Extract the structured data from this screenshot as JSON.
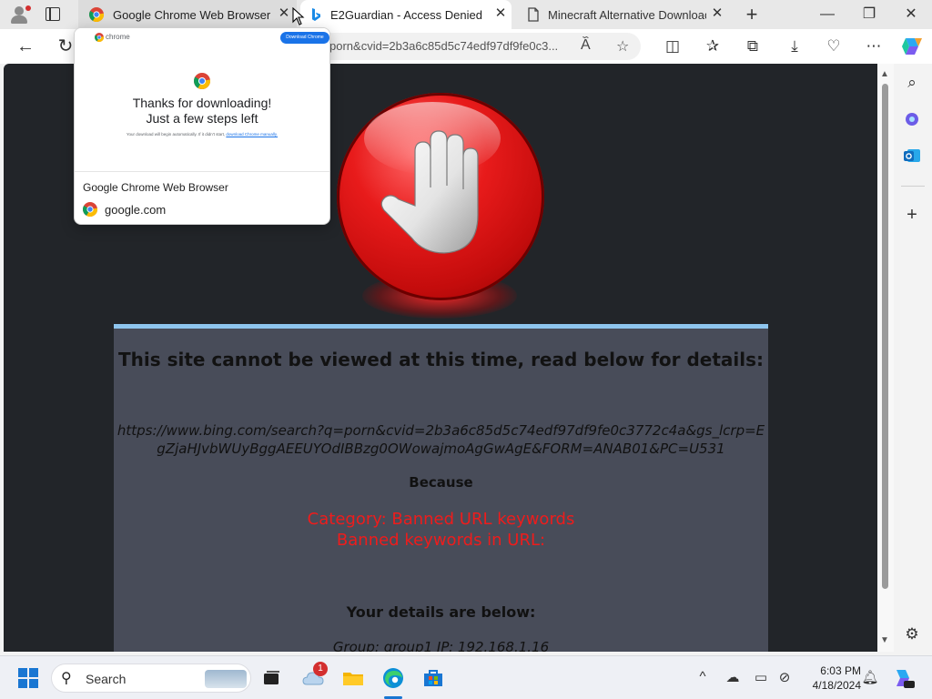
{
  "tabs": [
    {
      "title": "Google Chrome Web Browser",
      "favicon": "chrome-icon"
    },
    {
      "title": "E2Guardian - Access Denied",
      "favicon": "bing-icon"
    },
    {
      "title": "Minecraft Alternative Downloads",
      "favicon": "page-icon"
    }
  ],
  "toolbar": {
    "url": "porn&cvid=2b3a6c85d5c74edf97df9fe0c3..."
  },
  "preview": {
    "brand": "chrome",
    "download_button": "Download Chrome",
    "headline_1": "Thanks for downloading!",
    "headline_2": "Just a few steps left",
    "small_text": "Your download will begin automatically. If it didn't start,",
    "small_link": "download Chrome manually.",
    "title": "Google Chrome Web Browser",
    "domain": "google.com"
  },
  "notice": {
    "title": "This site cannot be viewed at this time, read below for details:",
    "url": "https://www.bing.com/search?q=porn&cvid=2b3a6c85d5c74edf97df9fe0c3772c4a&gs_lcrp=EgZjaHJvbWUyBggAEEUYOdIBBzg0OWowajmoAgGwAgE&FORM=ANAB01&PC=U531",
    "because": "Because",
    "category": "Category: Banned URL keywords",
    "category_detail": "Banned keywords in URL:",
    "details_heading": "Your details are below:",
    "group_line": "Group: group1   IP: 192.168.1.16"
  },
  "taskbar": {
    "search_label": "Search",
    "notification_count": "1",
    "time": "6:03 PM",
    "date": "4/18/2024"
  },
  "colors": {
    "accent": "#1976d2",
    "notice_bg": "#484c59",
    "notice_border": "#8ec5ee",
    "banned_text": "#ee1c1c",
    "page_bg": "#222529"
  }
}
